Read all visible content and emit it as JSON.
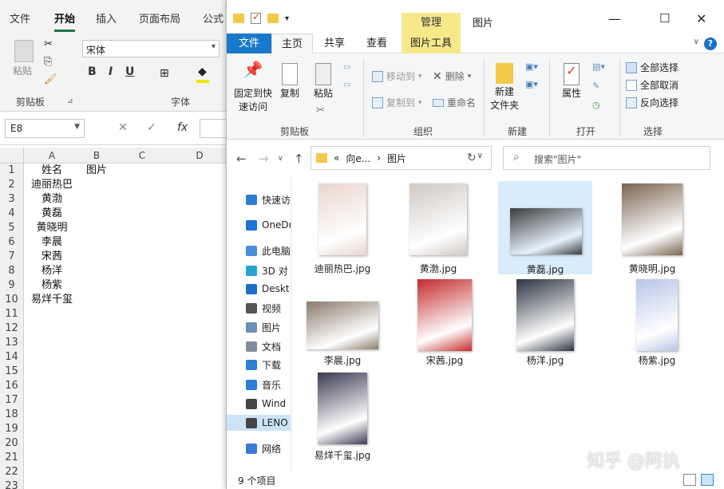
{
  "excel": {
    "tabs": [
      "文件",
      "开始",
      "插入",
      "页面布局",
      "公式"
    ],
    "active_tab": "开始",
    "clipboard": {
      "paste_label": "粘贴",
      "group_label": "剪贴板"
    },
    "font": {
      "name": "宋体",
      "group_label": "字体",
      "bold": "B",
      "italic": "I",
      "underline": "U"
    },
    "name_box": "E8",
    "formula_icons": {
      "cancel": "✕",
      "enter": "✓",
      "fx": "fx"
    },
    "columns": [
      "A",
      "B",
      "C",
      "D"
    ],
    "rows": [
      "1",
      "2",
      "3",
      "4",
      "5",
      "6",
      "7",
      "8",
      "9",
      "10",
      "11",
      "12",
      "13",
      "14",
      "15",
      "16",
      "17",
      "18",
      "19",
      "20",
      "21",
      "22",
      "23"
    ],
    "cells_A": [
      "姓名",
      "迪丽热巴",
      "黄渤",
      "黄磊",
      "黄晓明",
      "李晨",
      "宋茜",
      "杨洋",
      "杨紫",
      "易烊千玺"
    ],
    "cell_B1": "图片"
  },
  "explorer": {
    "title": "图片",
    "context_tab": "管理",
    "tabs": [
      {
        "label": "文件"
      },
      {
        "label": "主页"
      },
      {
        "label": "共享"
      },
      {
        "label": "查看"
      },
      {
        "label": "图片工具"
      }
    ],
    "ribbon": {
      "pin": "固定到快\n速访问",
      "copy": "复制",
      "paste": "粘贴",
      "clipboard_group": "剪贴板",
      "move_to": "移动到",
      "copy_to": "复制到",
      "delete": "删除",
      "rename": "重命名",
      "organize_group": "组织",
      "new_folder": "新建\n文件夹",
      "new_group": "新建",
      "properties": "属性",
      "open_group": "打开",
      "select_all": "全部选择",
      "select_none": "全部取消",
      "invert_selection": "反向选择",
      "select_group": "选择"
    },
    "address": {
      "prefix": "«",
      "segment1": "向e...",
      "sep": "›",
      "segment2": "图片"
    },
    "search_placeholder": "搜索\"图片\"",
    "nav": [
      {
        "label": "快速访",
        "icon": "star-icon",
        "color": "#2e7dd6"
      },
      {
        "label": "OneDr",
        "icon": "cloud-icon",
        "color": "#1a73d9"
      },
      {
        "label": "此电脑",
        "icon": "computer-icon",
        "color": "#4a90d9"
      },
      {
        "label": "3D 对",
        "icon": "cube-icon",
        "color": "#29a3d6"
      },
      {
        "label": "Deskt",
        "icon": "desktop-icon",
        "color": "#1e6fc8"
      },
      {
        "label": "视频",
        "icon": "video-icon",
        "color": "#555555"
      },
      {
        "label": "图片",
        "icon": "picture-icon",
        "color": "#6a8fb8"
      },
      {
        "label": "文档",
        "icon": "document-icon",
        "color": "#7f8c9a"
      },
      {
        "label": "下载",
        "icon": "download-icon",
        "color": "#2a7fd4"
      },
      {
        "label": "音乐",
        "icon": "music-icon",
        "color": "#2a7fd4"
      },
      {
        "label": "Wind",
        "icon": "drive-icon",
        "color": "#444444"
      },
      {
        "label": "LENO",
        "icon": "drive-icon",
        "color": "#444444"
      },
      {
        "label": "网络",
        "icon": "network-icon",
        "color": "#3a7bd5"
      }
    ],
    "files": [
      {
        "name": "迪丽热巴.jpg",
        "color": "#e8d6cc"
      },
      {
        "name": "黄渤.jpg",
        "color": "#cfc8c4"
      },
      {
        "name": "黄磊.jpg",
        "color": "#3b3b3b"
      },
      {
        "name": "黄晓明.jpg",
        "color": "#7a6450"
      },
      {
        "name": "李晨.jpg",
        "color": "#8a7a6a"
      },
      {
        "name": "宋茜.jpg",
        "color": "#c42a2a"
      },
      {
        "name": "杨洋.jpg",
        "color": "#2c3440"
      },
      {
        "name": "杨紫.jpg",
        "color": "#b7c6e6"
      },
      {
        "name": "易烊千玺.jpg",
        "color": "#3a3a52"
      }
    ],
    "selected_file": "黄磊.jpg",
    "status": "9 个项目"
  },
  "watermark": "知乎 @阿执"
}
